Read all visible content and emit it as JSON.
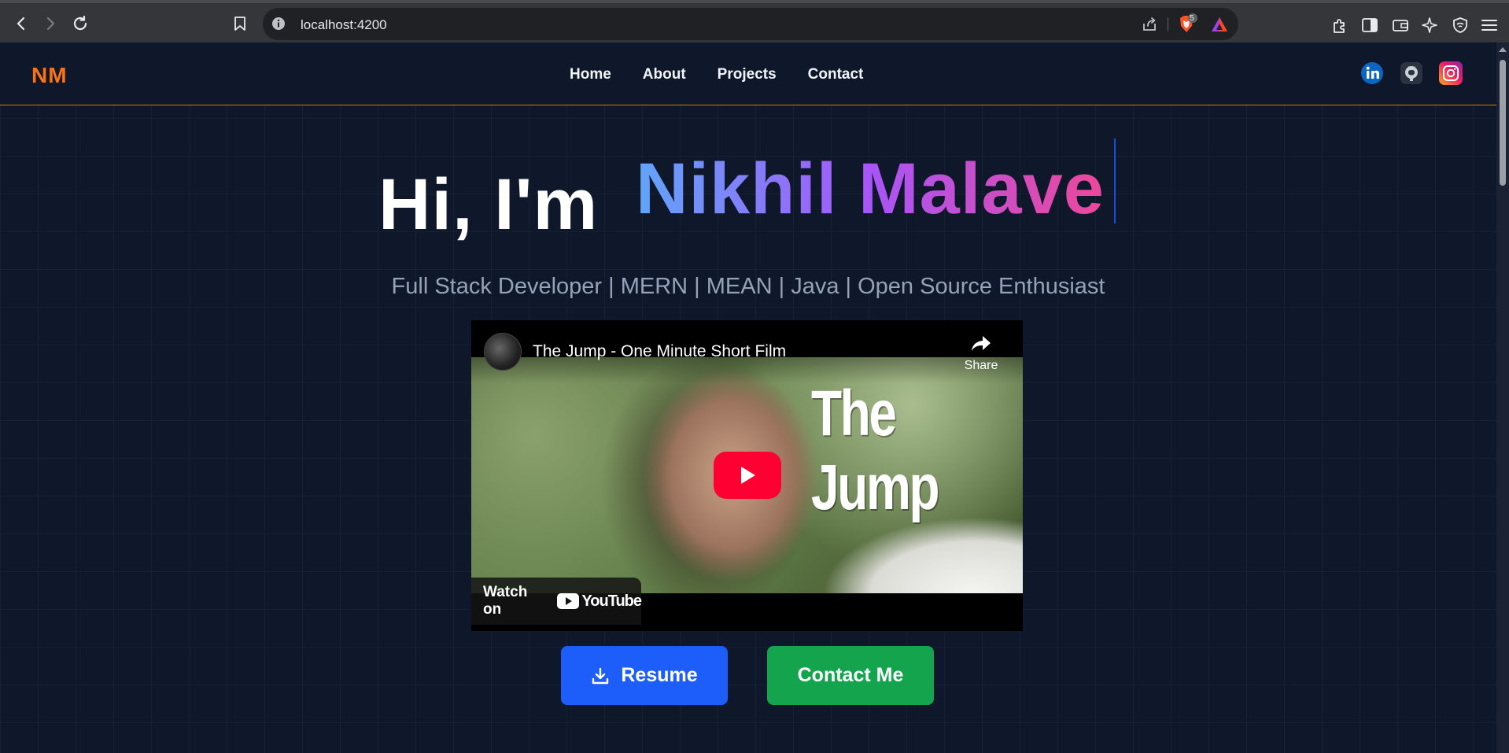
{
  "browser": {
    "url": "localhost:4200",
    "brave_badge_count": "5",
    "icons": [
      "back-icon",
      "forward-icon",
      "reload-icon",
      "bookmark-icon",
      "info-icon",
      "share-icon",
      "brave-shield-icon",
      "brave-rewards-icon",
      "extensions-icon",
      "sidebar-icon",
      "wallet-icon",
      "leo-ai-icon",
      "vpn-icon",
      "menu-icon"
    ]
  },
  "navbar": {
    "logo": "NM",
    "links": [
      "Home",
      "About",
      "Projects",
      "Contact"
    ],
    "social": [
      "linkedin-icon",
      "github-icon",
      "instagram-icon"
    ],
    "accent_color": "#d97706"
  },
  "hero": {
    "greeting": "Hi, I'm",
    "name": "Nikhil Malave",
    "subtitle": "Full Stack Developer | MERN | MEAN | Java | Open Source Enthusiast"
  },
  "video": {
    "title": "The Jump - One Minute Short Film",
    "share_label": "Share",
    "overlay_title": "The Jump",
    "watch_on": "Watch on",
    "platform": "YouTube"
  },
  "buttons": {
    "resume": "Resume",
    "contact": "Contact Me",
    "resume_color": "#1d5efb",
    "contact_color": "#14a44d"
  }
}
